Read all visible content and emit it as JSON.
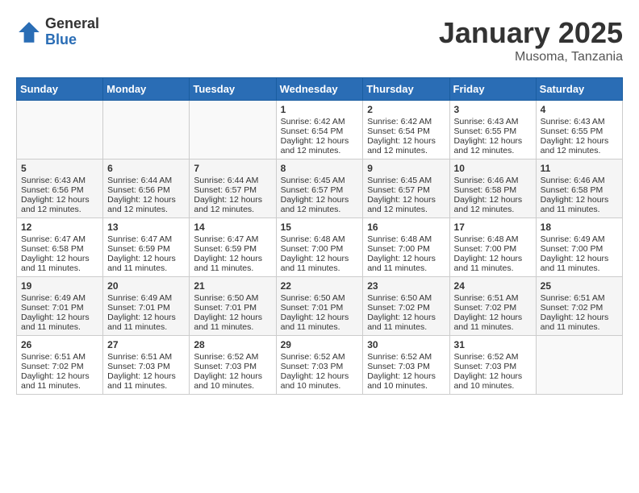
{
  "header": {
    "logo_general": "General",
    "logo_blue": "Blue",
    "month_title": "January 2025",
    "location": "Musoma, Tanzania"
  },
  "weekdays": [
    "Sunday",
    "Monday",
    "Tuesday",
    "Wednesday",
    "Thursday",
    "Friday",
    "Saturday"
  ],
  "weeks": [
    [
      {
        "day": "",
        "lines": []
      },
      {
        "day": "",
        "lines": []
      },
      {
        "day": "",
        "lines": []
      },
      {
        "day": "1",
        "lines": [
          "Sunrise: 6:42 AM",
          "Sunset: 6:54 PM",
          "Daylight: 12 hours",
          "and 12 minutes."
        ]
      },
      {
        "day": "2",
        "lines": [
          "Sunrise: 6:42 AM",
          "Sunset: 6:54 PM",
          "Daylight: 12 hours",
          "and 12 minutes."
        ]
      },
      {
        "day": "3",
        "lines": [
          "Sunrise: 6:43 AM",
          "Sunset: 6:55 PM",
          "Daylight: 12 hours",
          "and 12 minutes."
        ]
      },
      {
        "day": "4",
        "lines": [
          "Sunrise: 6:43 AM",
          "Sunset: 6:55 PM",
          "Daylight: 12 hours",
          "and 12 minutes."
        ]
      }
    ],
    [
      {
        "day": "5",
        "lines": [
          "Sunrise: 6:43 AM",
          "Sunset: 6:56 PM",
          "Daylight: 12 hours",
          "and 12 minutes."
        ]
      },
      {
        "day": "6",
        "lines": [
          "Sunrise: 6:44 AM",
          "Sunset: 6:56 PM",
          "Daylight: 12 hours",
          "and 12 minutes."
        ]
      },
      {
        "day": "7",
        "lines": [
          "Sunrise: 6:44 AM",
          "Sunset: 6:57 PM",
          "Daylight: 12 hours",
          "and 12 minutes."
        ]
      },
      {
        "day": "8",
        "lines": [
          "Sunrise: 6:45 AM",
          "Sunset: 6:57 PM",
          "Daylight: 12 hours",
          "and 12 minutes."
        ]
      },
      {
        "day": "9",
        "lines": [
          "Sunrise: 6:45 AM",
          "Sunset: 6:57 PM",
          "Daylight: 12 hours",
          "and 12 minutes."
        ]
      },
      {
        "day": "10",
        "lines": [
          "Sunrise: 6:46 AM",
          "Sunset: 6:58 PM",
          "Daylight: 12 hours",
          "and 12 minutes."
        ]
      },
      {
        "day": "11",
        "lines": [
          "Sunrise: 6:46 AM",
          "Sunset: 6:58 PM",
          "Daylight: 12 hours",
          "and 11 minutes."
        ]
      }
    ],
    [
      {
        "day": "12",
        "lines": [
          "Sunrise: 6:47 AM",
          "Sunset: 6:58 PM",
          "Daylight: 12 hours",
          "and 11 minutes."
        ]
      },
      {
        "day": "13",
        "lines": [
          "Sunrise: 6:47 AM",
          "Sunset: 6:59 PM",
          "Daylight: 12 hours",
          "and 11 minutes."
        ]
      },
      {
        "day": "14",
        "lines": [
          "Sunrise: 6:47 AM",
          "Sunset: 6:59 PM",
          "Daylight: 12 hours",
          "and 11 minutes."
        ]
      },
      {
        "day": "15",
        "lines": [
          "Sunrise: 6:48 AM",
          "Sunset: 7:00 PM",
          "Daylight: 12 hours",
          "and 11 minutes."
        ]
      },
      {
        "day": "16",
        "lines": [
          "Sunrise: 6:48 AM",
          "Sunset: 7:00 PM",
          "Daylight: 12 hours",
          "and 11 minutes."
        ]
      },
      {
        "day": "17",
        "lines": [
          "Sunrise: 6:48 AM",
          "Sunset: 7:00 PM",
          "Daylight: 12 hours",
          "and 11 minutes."
        ]
      },
      {
        "day": "18",
        "lines": [
          "Sunrise: 6:49 AM",
          "Sunset: 7:00 PM",
          "Daylight: 12 hours",
          "and 11 minutes."
        ]
      }
    ],
    [
      {
        "day": "19",
        "lines": [
          "Sunrise: 6:49 AM",
          "Sunset: 7:01 PM",
          "Daylight: 12 hours",
          "and 11 minutes."
        ]
      },
      {
        "day": "20",
        "lines": [
          "Sunrise: 6:49 AM",
          "Sunset: 7:01 PM",
          "Daylight: 12 hours",
          "and 11 minutes."
        ]
      },
      {
        "day": "21",
        "lines": [
          "Sunrise: 6:50 AM",
          "Sunset: 7:01 PM",
          "Daylight: 12 hours",
          "and 11 minutes."
        ]
      },
      {
        "day": "22",
        "lines": [
          "Sunrise: 6:50 AM",
          "Sunset: 7:01 PM",
          "Daylight: 12 hours",
          "and 11 minutes."
        ]
      },
      {
        "day": "23",
        "lines": [
          "Sunrise: 6:50 AM",
          "Sunset: 7:02 PM",
          "Daylight: 12 hours",
          "and 11 minutes."
        ]
      },
      {
        "day": "24",
        "lines": [
          "Sunrise: 6:51 AM",
          "Sunset: 7:02 PM",
          "Daylight: 12 hours",
          "and 11 minutes."
        ]
      },
      {
        "day": "25",
        "lines": [
          "Sunrise: 6:51 AM",
          "Sunset: 7:02 PM",
          "Daylight: 12 hours",
          "and 11 minutes."
        ]
      }
    ],
    [
      {
        "day": "26",
        "lines": [
          "Sunrise: 6:51 AM",
          "Sunset: 7:02 PM",
          "Daylight: 12 hours",
          "and 11 minutes."
        ]
      },
      {
        "day": "27",
        "lines": [
          "Sunrise: 6:51 AM",
          "Sunset: 7:03 PM",
          "Daylight: 12 hours",
          "and 11 minutes."
        ]
      },
      {
        "day": "28",
        "lines": [
          "Sunrise: 6:52 AM",
          "Sunset: 7:03 PM",
          "Daylight: 12 hours",
          "and 10 minutes."
        ]
      },
      {
        "day": "29",
        "lines": [
          "Sunrise: 6:52 AM",
          "Sunset: 7:03 PM",
          "Daylight: 12 hours",
          "and 10 minutes."
        ]
      },
      {
        "day": "30",
        "lines": [
          "Sunrise: 6:52 AM",
          "Sunset: 7:03 PM",
          "Daylight: 12 hours",
          "and 10 minutes."
        ]
      },
      {
        "day": "31",
        "lines": [
          "Sunrise: 6:52 AM",
          "Sunset: 7:03 PM",
          "Daylight: 12 hours",
          "and 10 minutes."
        ]
      },
      {
        "day": "",
        "lines": []
      }
    ]
  ]
}
